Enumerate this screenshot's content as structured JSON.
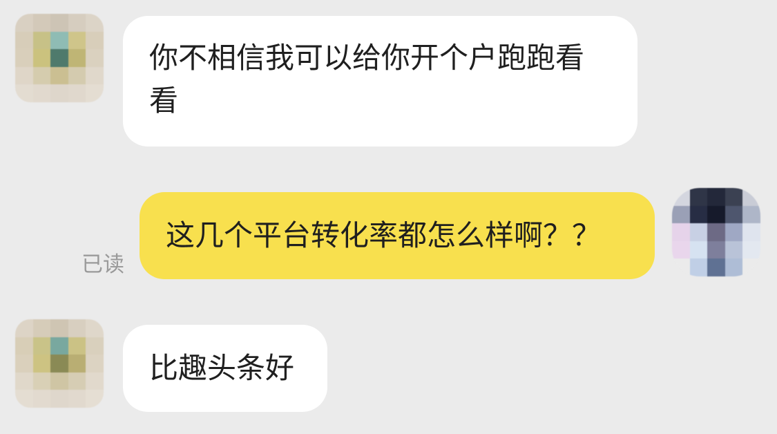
{
  "chat": {
    "messages": [
      {
        "sender": "other",
        "text": "你不相信我可以给你开个户跑跑看看"
      },
      {
        "sender": "me",
        "text": "这几个平台转化率都怎么样啊？？",
        "status": "已读"
      },
      {
        "sender": "other",
        "text": "比趣头条好"
      }
    ]
  },
  "colors": {
    "background": "#ebebeb",
    "incoming_bubble": "#ffffff",
    "outgoing_bubble": "#f8e04e",
    "read_status": "#9a9a9a"
  }
}
